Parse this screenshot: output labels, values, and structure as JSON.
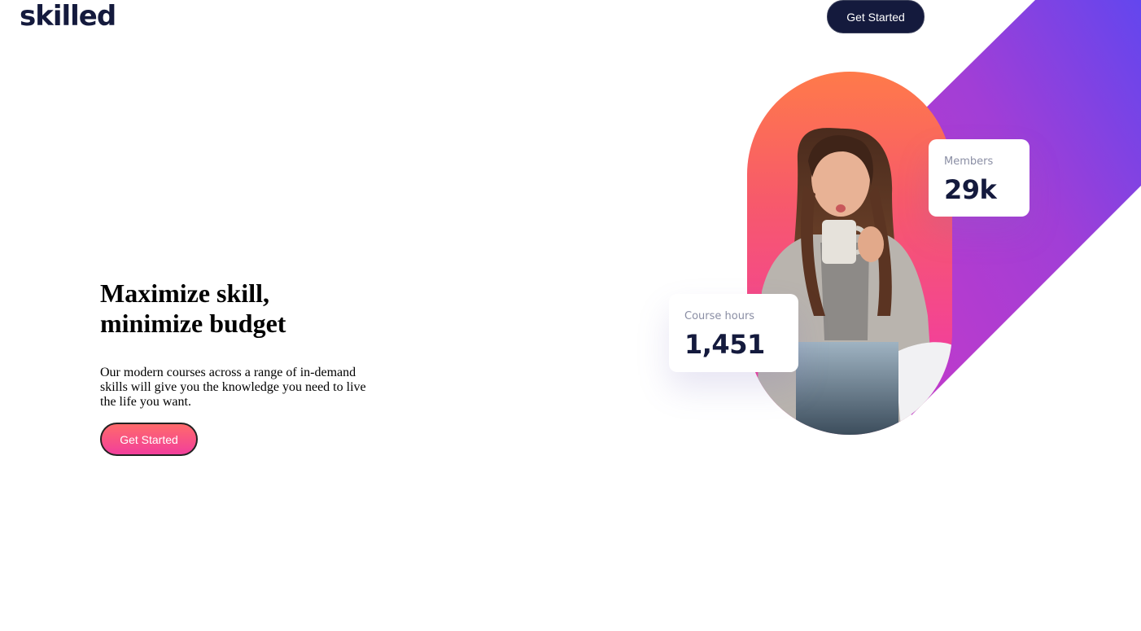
{
  "header": {
    "logo": "skilled",
    "cta_label": "Get Started"
  },
  "hero": {
    "title_line1": "Maximize skill,",
    "title_line2": "minimize budget",
    "description": "Our modern courses across a range of in-demand skills will give you the knowledge you need to live the life you want.",
    "cta_label": "Get Started"
  },
  "stats": {
    "members": {
      "label": "Members",
      "value": "29k"
    },
    "course_hours": {
      "label": "Course hours",
      "value": "1,451"
    }
  },
  "colors": {
    "brand_dark": "#141a3d",
    "accent_orange": "#ff7a4a",
    "accent_pink": "#f23f9c",
    "accent_purple": "#6b45ee"
  },
  "images": {
    "hero_photo": "woman-drinking-coffee-with-laptop"
  }
}
